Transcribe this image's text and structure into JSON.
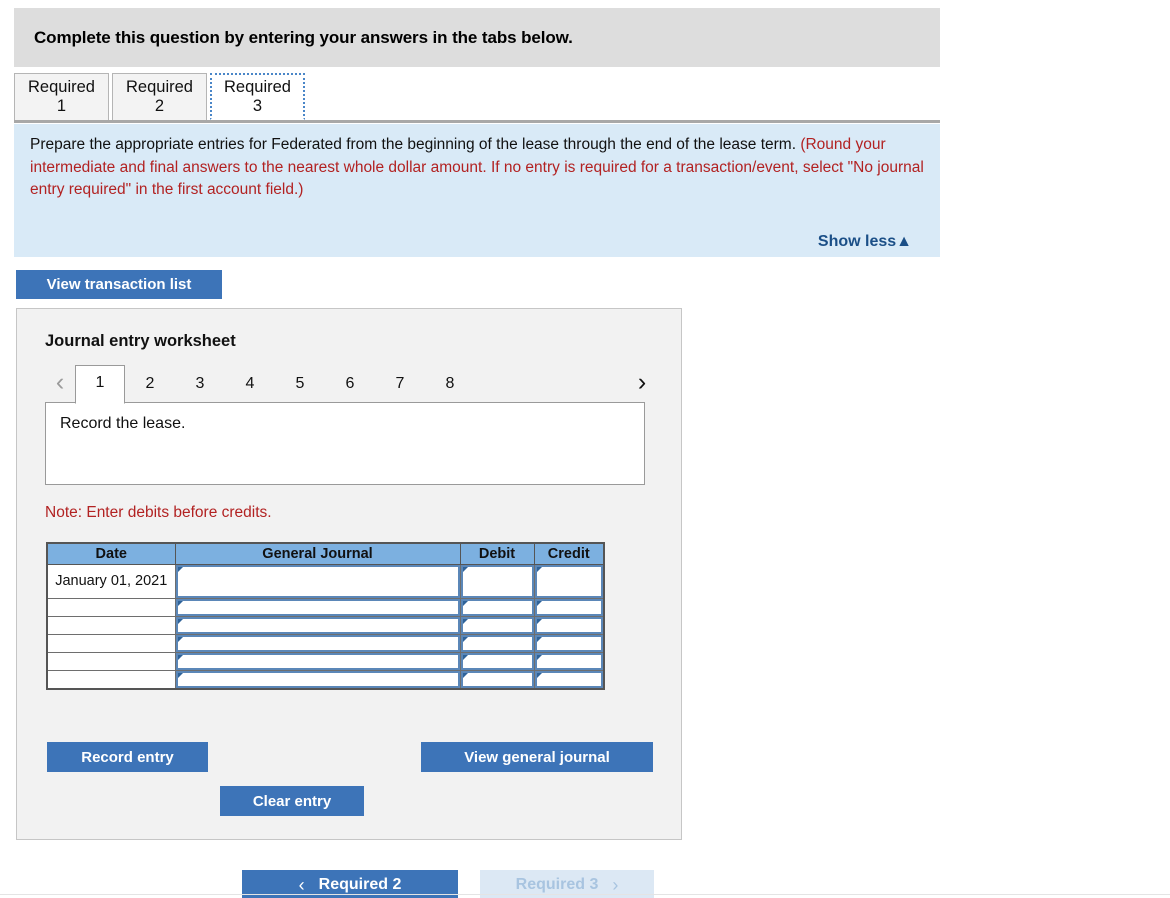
{
  "header": {
    "title": "Complete this question by entering your answers in the tabs below."
  },
  "tabs": [
    {
      "label_line1": "Required",
      "label_line2": "1",
      "active": false
    },
    {
      "label_line1": "Required",
      "label_line2": "2",
      "active": false
    },
    {
      "label_line1": "Required",
      "label_line2": "3",
      "active": true
    }
  ],
  "instructions": {
    "bold_part": "Prepare the appropriate entries for Federated from the beginning of the lease through the end of the lease term. ",
    "red_part": "(Round your intermediate and final answers to the nearest whole dollar amount. If no entry is required for a transaction/event, select \"No journal entry required\" in the first account field.)",
    "show_less_label": "Show less▲"
  },
  "toolbar": {
    "view_transaction_list_label": "View transaction list"
  },
  "worksheet": {
    "title": "Journal entry worksheet",
    "pager": {
      "prev_icon": "chevron-left-icon",
      "next_icon": "chevron-right-icon",
      "prev_glyph": "‹",
      "next_glyph": "›",
      "pages": [
        "1",
        "2",
        "3",
        "4",
        "5",
        "6",
        "7",
        "8"
      ],
      "active_page": "1"
    },
    "description": "Record the lease.",
    "note": "Note: Enter debits before credits.",
    "table": {
      "columns": [
        "Date",
        "General Journal",
        "Debit",
        "Credit"
      ],
      "rows": [
        {
          "date": "January 01, 2021",
          "general_journal": "",
          "debit": "",
          "credit": ""
        },
        {
          "date": "",
          "general_journal": "",
          "debit": "",
          "credit": ""
        },
        {
          "date": "",
          "general_journal": "",
          "debit": "",
          "credit": ""
        },
        {
          "date": "",
          "general_journal": "",
          "debit": "",
          "credit": ""
        },
        {
          "date": "",
          "general_journal": "",
          "debit": "",
          "credit": ""
        },
        {
          "date": "",
          "general_journal": "",
          "debit": "",
          "credit": ""
        }
      ]
    },
    "buttons": {
      "record_entry": "Record entry",
      "clear_entry": "Clear entry",
      "view_general_journal": "View general journal"
    }
  },
  "bottom_nav": {
    "prev_label": "Required 2",
    "next_label": "Required 3",
    "prev_glyph": "‹",
    "next_glyph": "›"
  },
  "colors": {
    "accent_blue": "#3d74b8",
    "header_gray": "#dddddd",
    "instruction_blue": "#d9eaf7",
    "table_header_blue": "#7cb0e0",
    "red_text": "#b22222",
    "link_navy": "#1b4f87"
  }
}
